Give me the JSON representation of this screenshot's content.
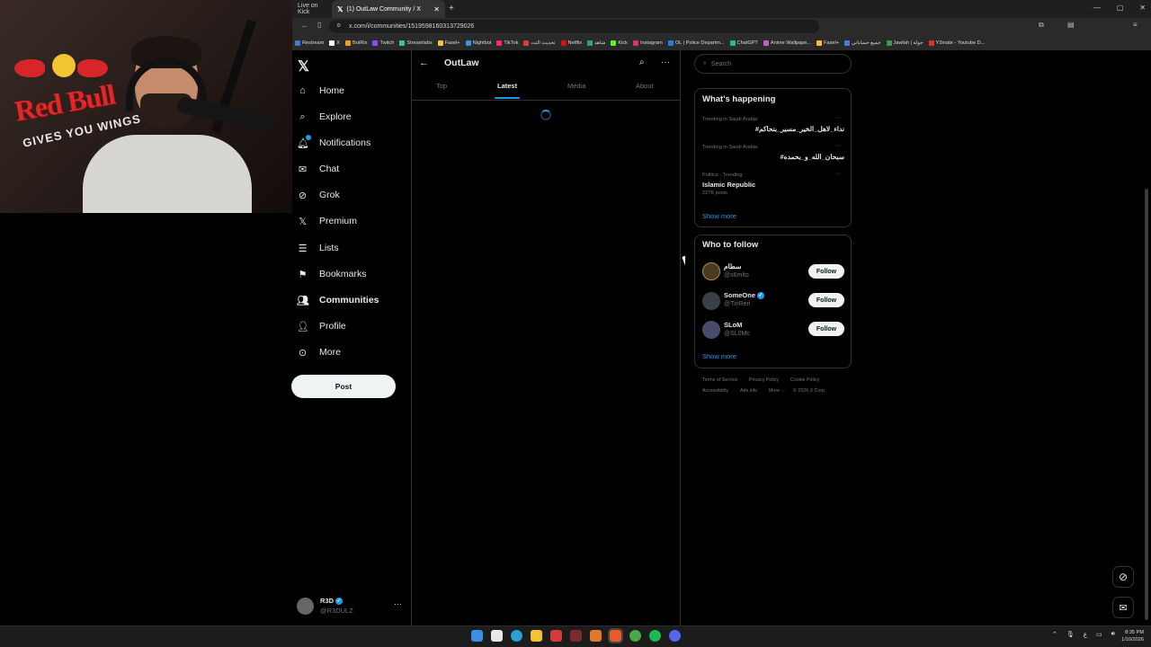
{
  "browser": {
    "tabs": [
      {
        "label": "Live on Kick"
      },
      {
        "label": "(1) OutLaw Community / X"
      }
    ],
    "new_tab": "+",
    "url": "x.com/i/communities/1519598160313729026",
    "bookmarks": [
      "Restream",
      "X",
      "BotRix",
      "Twitch",
      "Streamlabs",
      "Fasel+",
      "Nightbot",
      "TikTok",
      "تحديث النت",
      "Netflix",
      "شاهد",
      "Kick",
      "Instagram",
      "OL | Police Departm...",
      "ChatGPT",
      "Anime Wallpape...",
      "Fasel+",
      "جميع حساباتي",
      "Jawlah | جولة",
      "Y2mate - Youtube D..."
    ],
    "window_controls": [
      "—",
      "▢",
      "✕"
    ]
  },
  "nav": {
    "items": [
      {
        "label": "Home"
      },
      {
        "label": "Explore"
      },
      {
        "label": "Notifications"
      },
      {
        "label": "Chat"
      },
      {
        "label": "Grok"
      },
      {
        "label": "Premium"
      },
      {
        "label": "Lists"
      },
      {
        "label": "Bookmarks"
      },
      {
        "label": "Communities"
      },
      {
        "label": "Profile"
      },
      {
        "label": "More"
      }
    ],
    "post_label": "Post",
    "account": {
      "name": "R3D",
      "handle": "@R3DULZ"
    }
  },
  "community": {
    "title": "OutLaw",
    "tabs": [
      "Top",
      "Latest",
      "Media",
      "About"
    ],
    "active_tab": "Latest"
  },
  "right": {
    "search_placeholder": "Search",
    "happening_title": "What's happening",
    "trends": [
      {
        "context": "Trending in Saudi Arabia",
        "name": "#نداء_لاهل_الخير_مسير_بنحاكم",
        "count": ""
      },
      {
        "context": "Trending in Saudi Arabia",
        "name": "#سبحان_الله_و_بحمده",
        "count": ""
      },
      {
        "context": "Politics · Trending",
        "name": "Islamic Republic",
        "count": "227K posts"
      }
    ],
    "show_more": "Show more",
    "who_title": "Who to follow",
    "suggestions": [
      {
        "name": "سطام",
        "handle": "@s6mlto",
        "verified": false
      },
      {
        "name": "SomeOne",
        "handle": "@TiriReri",
        "verified": true
      },
      {
        "name": "SLoM",
        "handle": "@SL0Mc",
        "verified": false
      }
    ],
    "follow_label": "Follow",
    "footer_links": [
      "Terms of Service",
      "Privacy Policy",
      "Cookie Policy",
      "Accessibility",
      "Ads info",
      "More ···",
      "© 2026 X Corp."
    ]
  },
  "system": {
    "time": "8:35 PM",
    "date": "1/10/2026",
    "lang": "ع"
  },
  "colors": {
    "accent": "#1d9bf0",
    "bg": "#000000",
    "border": "#2f3336"
  }
}
